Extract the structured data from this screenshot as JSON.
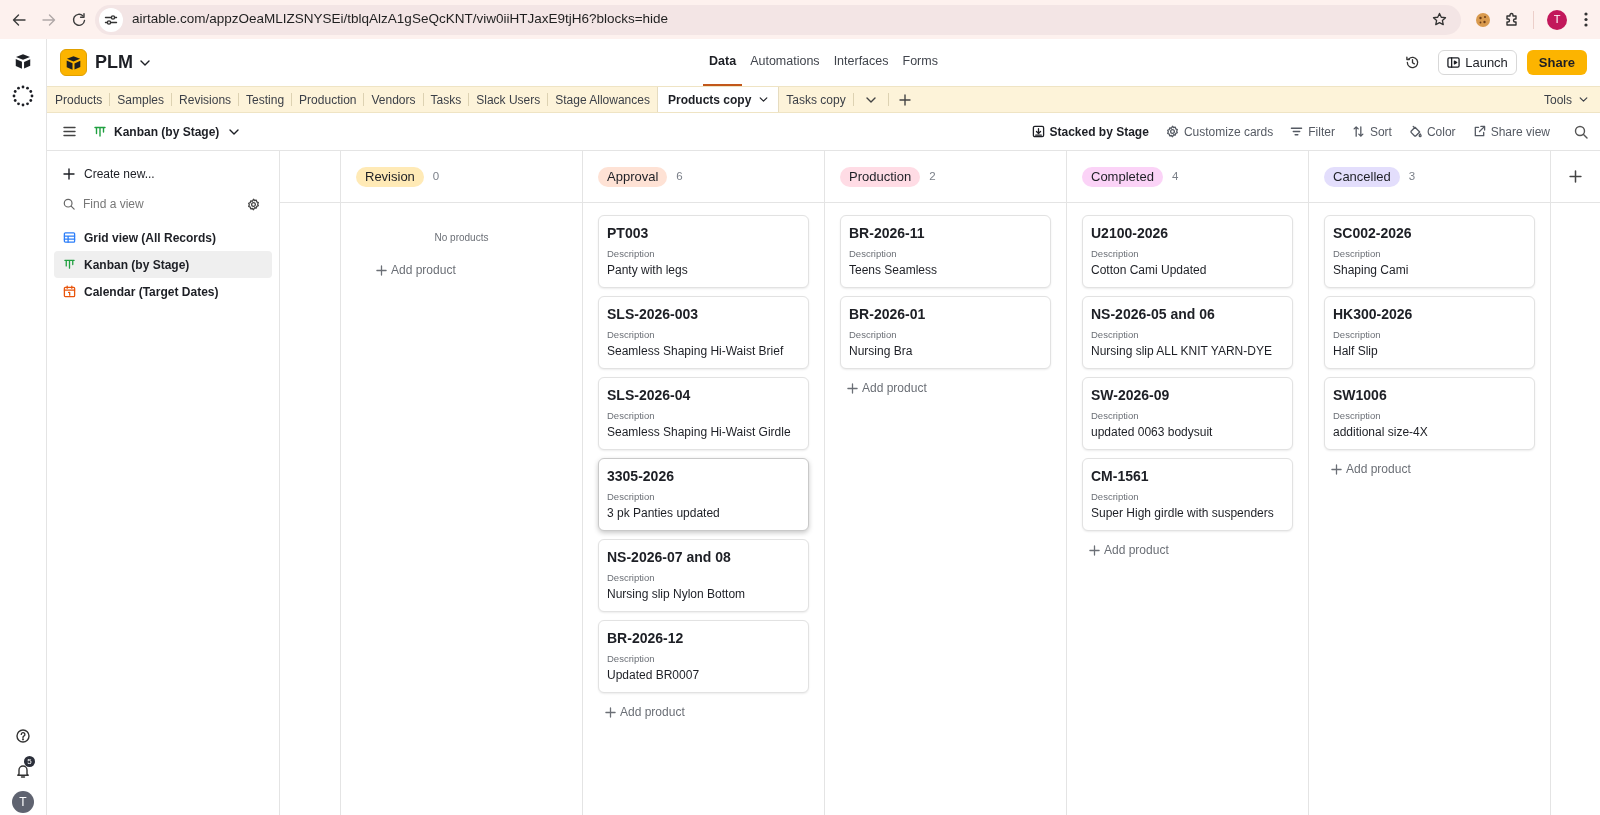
{
  "browser": {
    "url": "airtable.com/appzOeaMLIZSNYSEi/tblqAlzA1gSeQcKNT/viw0iiHTJaxE9tjH6?blocks=hide",
    "profile_initial": "T"
  },
  "rail": {
    "notification_count": "5",
    "avatar_initial": "T"
  },
  "header": {
    "base_name": "PLM",
    "nav": [
      {
        "label": "Data",
        "selected": true
      },
      {
        "label": "Automations",
        "selected": false
      },
      {
        "label": "Interfaces",
        "selected": false
      },
      {
        "label": "Forms",
        "selected": false
      }
    ],
    "launch_label": "Launch",
    "share_label": "Share"
  },
  "table_tabs": {
    "tabs": [
      {
        "label": "Products",
        "selected": false
      },
      {
        "label": "Samples",
        "selected": false
      },
      {
        "label": "Revisions",
        "selected": false
      },
      {
        "label": "Testing",
        "selected": false
      },
      {
        "label": "Production",
        "selected": false
      },
      {
        "label": "Vendors",
        "selected": false
      },
      {
        "label": "Tasks",
        "selected": false
      },
      {
        "label": "Slack Users",
        "selected": false
      },
      {
        "label": "Stage Allowances",
        "selected": false
      },
      {
        "label": "Products copy",
        "selected": true
      },
      {
        "label": "Tasks copy",
        "selected": false
      }
    ],
    "tools_label": "Tools"
  },
  "view_bar": {
    "view_name": "Kanban (by Stage)",
    "actions": [
      {
        "kind": "stack",
        "label": "Stacked by Stage"
      },
      {
        "kind": "customize",
        "label": "Customize cards"
      },
      {
        "kind": "filter",
        "label": "Filter"
      },
      {
        "kind": "sort",
        "label": "Sort"
      },
      {
        "kind": "color",
        "label": "Color"
      },
      {
        "kind": "share",
        "label": "Share view"
      }
    ]
  },
  "sidebar": {
    "create_label": "Create new...",
    "search": {
      "placeholder": "Find a view"
    },
    "views": [
      {
        "kind": "grid",
        "label": "Grid view (All Records)",
        "selected": false
      },
      {
        "kind": "kanban",
        "label": "Kanban (by Stage)",
        "selected": true
      },
      {
        "kind": "calendar",
        "label": "Calendar (Target Dates)",
        "selected": false
      }
    ]
  },
  "board": {
    "columns": [
      {
        "stage": "Revision",
        "count": "0",
        "color": "#ffeab6",
        "empty_text": "No products",
        "add_label": "Add product"
      },
      {
        "stage": "Approval",
        "count": "6",
        "color": "#fee2d5",
        "cards": [
          {
            "title": "PT003",
            "field_label": "Description",
            "value": "Panty with legs",
            "hovered": false
          },
          {
            "title": "SLS-2026-003",
            "field_label": "Description",
            "value": "Seamless Shaping Hi-Waist Brief",
            "hovered": false
          },
          {
            "title": "SLS-2026-04",
            "field_label": "Description",
            "value": "Seamless Shaping Hi-Waist Girdle",
            "hovered": false
          },
          {
            "title": "3305-2026",
            "field_label": "Description",
            "value": "3 pk Panties updated",
            "hovered": true
          },
          {
            "title": "NS-2026-07 and 08",
            "field_label": "Description",
            "value": "Nursing slip Nylon Bottom",
            "hovered": false
          },
          {
            "title": "BR-2026-12",
            "field_label": "Description",
            "value": "Updated BR0007",
            "hovered": false
          }
        ],
        "add_label": "Add product"
      },
      {
        "stage": "Production",
        "count": "2",
        "color": "#ffdce5",
        "cards": [
          {
            "title": "BR-2026-11",
            "field_label": "Description",
            "value": "Teens Seamless",
            "hovered": false
          },
          {
            "title": "BR-2026-01",
            "field_label": "Description",
            "value": "Nursing Bra",
            "hovered": false
          }
        ],
        "add_label": "Add product"
      },
      {
        "stage": "Completed",
        "count": "4",
        "color": "#fbd3f7",
        "cards": [
          {
            "title": "U2100-2026",
            "field_label": "Description",
            "value": "Cotton Cami Updated",
            "hovered": false
          },
          {
            "title": "NS-2026-05 and 06",
            "field_label": "Description",
            "value": "Nursing slip ALL KNIT YARN-DYE",
            "hovered": false
          },
          {
            "title": "SW-2026-09",
            "field_label": "Description",
            "value": "updated 0063 bodysuit",
            "hovered": false
          },
          {
            "title": "CM-1561",
            "field_label": "Description",
            "value": "Super High girdle with suspenders",
            "hovered": false
          }
        ],
        "add_label": "Add product"
      },
      {
        "stage": "Cancelled",
        "count": "3",
        "color": "#e3defc",
        "cards": [
          {
            "title": "SC002-2026",
            "field_label": "Description",
            "value": "Shaping Cami",
            "hovered": false
          },
          {
            "title": "HK300-2026",
            "field_label": "Description",
            "value": "Half Slip",
            "hovered": false
          },
          {
            "title": "SW1006",
            "field_label": "Description",
            "value": "additional size-4X",
            "hovered": false
          }
        ],
        "add_label": "Add product"
      }
    ]
  }
}
